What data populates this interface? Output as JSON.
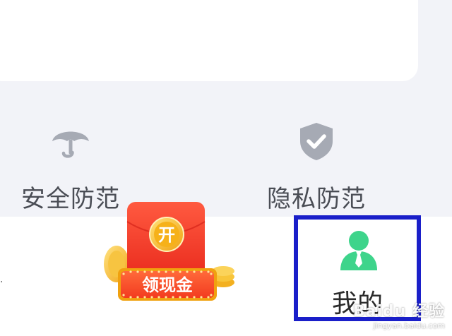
{
  "features": [
    {
      "label": "安全防范",
      "icon": "umbrella-icon"
    },
    {
      "label": "隐私防范",
      "icon": "shield-check-icon"
    }
  ],
  "promo": {
    "open_label": "开",
    "cta_label": "领现金"
  },
  "nav": {
    "mine_label": "我的",
    "mine_icon": "user-tie-icon"
  },
  "watermark": {
    "brand": "Baidu 经验",
    "url": "jingyan.baidu.com"
  },
  "colors": {
    "highlight": "#1a1fc9",
    "user_icon": "#3ed48b",
    "icon_gray": "#a6aab4",
    "red": "#f23c2a",
    "gold": "#f6b11a"
  }
}
